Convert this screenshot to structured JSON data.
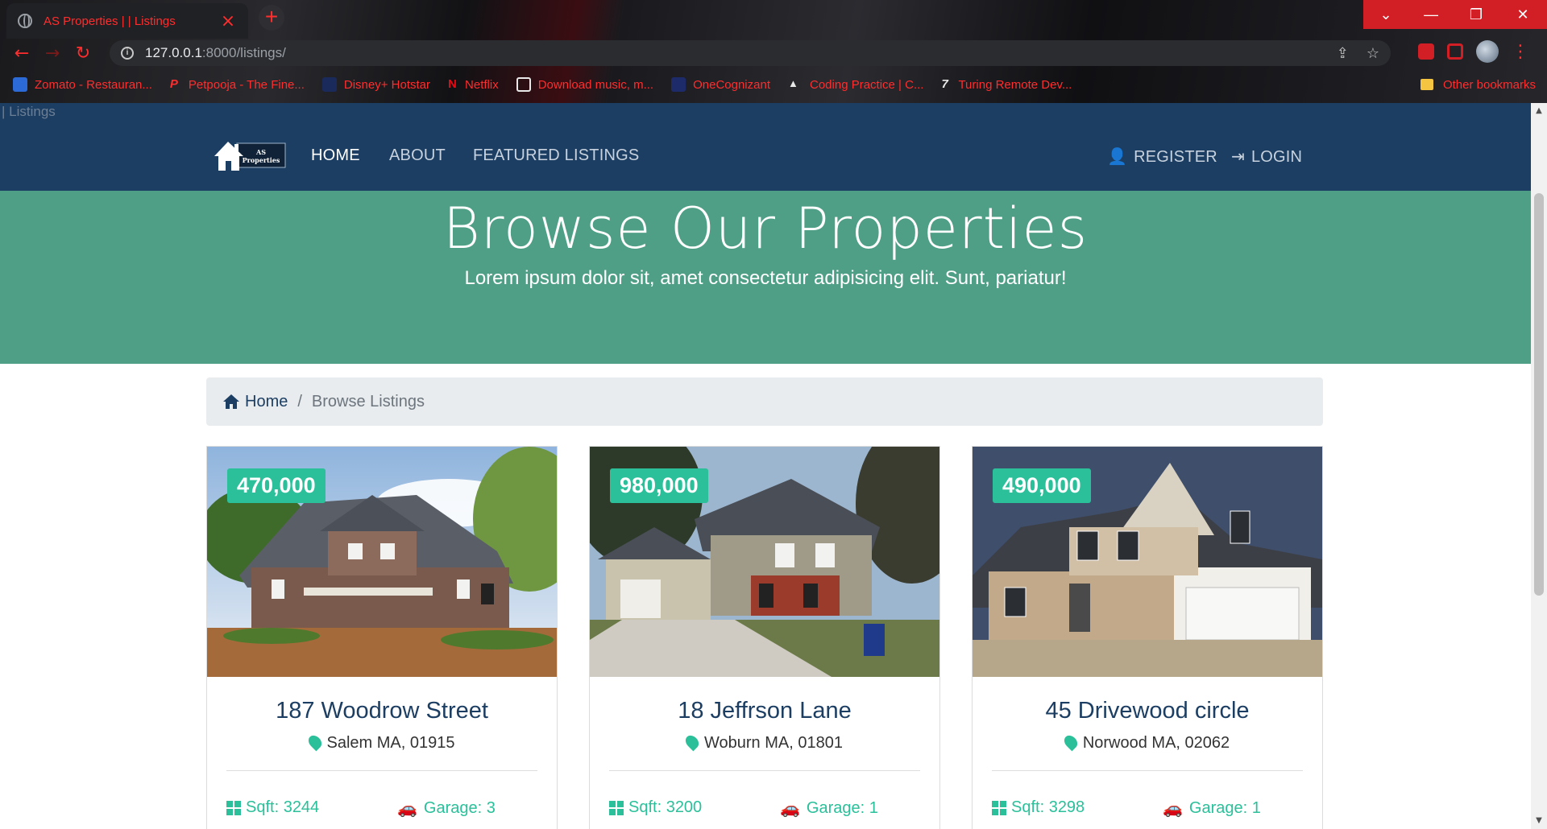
{
  "browser": {
    "tab_title": "AS Properties | | Listings",
    "url_host": "127.0.0.1",
    "url_path": ":8000/listings/",
    "bookmarks": [
      {
        "label": "Zomato - Restauran...",
        "color": "#2c6ad8"
      },
      {
        "label": "Petpooja - The Fine...",
        "color": "#ff2d2d"
      },
      {
        "label": "Disney+ Hotstar",
        "color": "#1a2a5a"
      },
      {
        "label": "Netflix",
        "color": "#e50914"
      },
      {
        "label": "Download music, m...",
        "color": "#e8e8e8"
      },
      {
        "label": "OneCognizant",
        "color": "#1d2b6b"
      },
      {
        "label": "Coding Practice | C...",
        "color": "#e8e8e8"
      },
      {
        "label": "Turing Remote Dev...",
        "color": "#e8e8e8"
      }
    ],
    "other_bookmarks": "Other bookmarks"
  },
  "page": {
    "topbar_text": "| Listings",
    "logo_text_1": "AS",
    "logo_text_2": "Properties",
    "nav": {
      "home": "HOME",
      "about": "ABOUT",
      "featured": "FEATURED LISTINGS",
      "register": "REGISTER",
      "login": "LOGIN"
    },
    "hero": {
      "title": "Browse Our Properties",
      "subtitle": "Lorem ipsum dolor sit, amet consectetur adipisicing elit. Sunt, pariatur!"
    },
    "breadcrumb": {
      "home": "Home",
      "separator": "/",
      "current": "Browse Listings"
    },
    "listings": [
      {
        "price": "470,000",
        "title": "187 Woodrow Street",
        "location": "Salem MA, 01915",
        "sqft": "Sqft: 3244",
        "garage": "Garage: 3"
      },
      {
        "price": "980,000",
        "title": "18 Jeffrson Lane",
        "location": "Woburn MA, 01801",
        "sqft": "Sqft: 3200",
        "garage": "Garage: 1"
      },
      {
        "price": "490,000",
        "title": "45 Drivewood circle",
        "location": "Norwood MA, 02062",
        "sqft": "Sqft: 3298",
        "garage": "Garage: 1"
      }
    ]
  },
  "colors": {
    "navbar": "#1c3e63",
    "hero": "#4f9f87",
    "accent": "#2bc09a",
    "browser_accent": "#ff2d2d"
  }
}
